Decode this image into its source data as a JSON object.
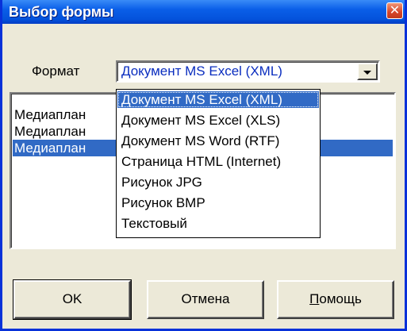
{
  "window": {
    "title": "Выбор формы",
    "close_glyph": "✕"
  },
  "format": {
    "label": "Формат",
    "selected": "Документ MS Excel (XML)",
    "options": [
      "Документ MS Excel (XML)",
      "Документ MS Excel (XLS)",
      "Документ MS Word (RTF)",
      "Страница HTML (Internet)",
      "Рисунок JPG",
      "Рисунок BMP",
      "Текстовый"
    ]
  },
  "list": {
    "items": [
      "Медиаплан",
      "Медиаплан",
      "Медиаплан"
    ],
    "selected_index": 2
  },
  "buttons": {
    "ok": "OK",
    "cancel": "Отмена",
    "help_mnemonic": "П",
    "help_rest": "омощь"
  },
  "colors": {
    "title_bar": "#0a5ee8",
    "selection": "#316ac5",
    "face": "#ece9d8"
  }
}
